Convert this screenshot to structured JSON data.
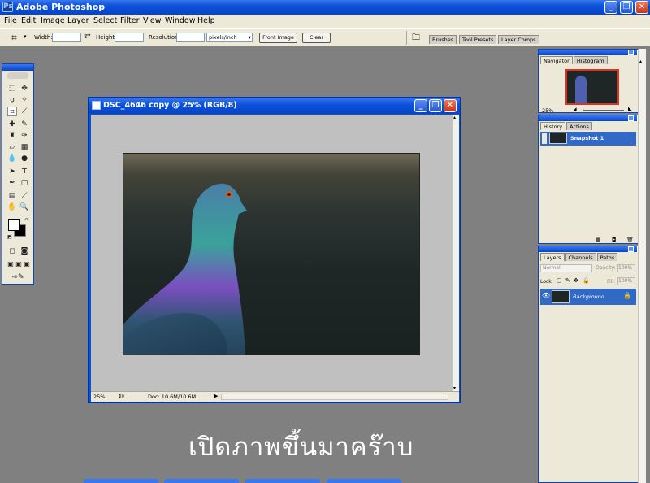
{
  "window": {
    "title": "Adobe Photoshop"
  },
  "menu": [
    "File",
    "Edit",
    "Image",
    "Layer",
    "Select",
    "Filter",
    "View",
    "Window",
    "Help"
  ],
  "options": {
    "width_label": "Width:",
    "height_label": "Height:",
    "resolution_label": "Resolution:",
    "resolution_unit": "pixels/inch",
    "front_image_label": "Front Image",
    "clear_label": "Clear",
    "well_tabs": [
      "Brushes",
      "Tool Presets",
      "Layer Comps"
    ]
  },
  "document": {
    "title": "DSC_4646 copy @ 25% (RGB/8)",
    "zoom": "25%",
    "doc_size": "Doc: 10.6M/10.6M"
  },
  "navigator": {
    "tabs": [
      "Navigator",
      "Histogram"
    ],
    "zoom": "25%"
  },
  "history": {
    "tabs": [
      "History",
      "Actions"
    ],
    "items": [
      "Snapshot 1"
    ]
  },
  "layers": {
    "tabs": [
      "Layers",
      "Channels",
      "Paths"
    ],
    "blend_mode": "Normal",
    "opacity_label": "Opacity:",
    "opacity": "100%",
    "lock_label": "Lock:",
    "fill_label": "Fill:",
    "fill": "100%",
    "items": [
      "Background"
    ]
  },
  "caption": "เปิดภาพขึ้นมาคร๊าบ",
  "colors": {
    "xp_blue": "#0a52d9",
    "selection": "#3169c6",
    "canvas_gray": "#c0c0c0",
    "workspace": "#808080"
  }
}
